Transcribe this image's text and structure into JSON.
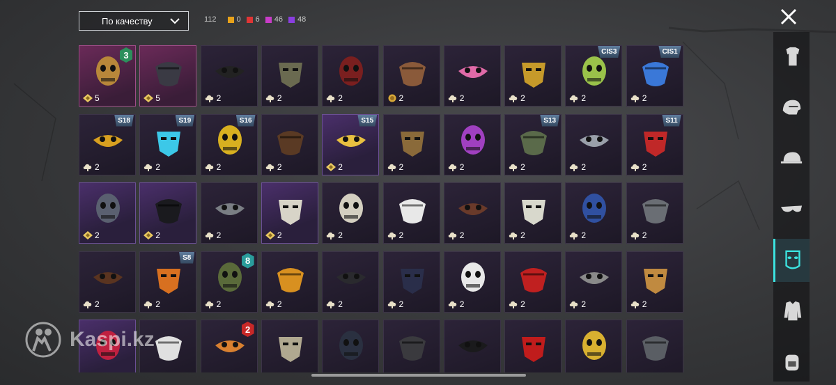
{
  "sort": {
    "label": "По качеству"
  },
  "counts": {
    "total": "112",
    "tiers": [
      {
        "value": "0",
        "color": "#e8a21a"
      },
      {
        "value": "6",
        "color": "#e03535"
      },
      {
        "value": "46",
        "color": "#c83cc8"
      },
      {
        "value": "48",
        "color": "#8a3ee0"
      }
    ]
  },
  "sidebar": {
    "categories": [
      {
        "name": "outfit",
        "icon": "outfit-icon"
      },
      {
        "name": "helmet",
        "icon": "helmet-icon"
      },
      {
        "name": "hat",
        "icon": "cap-icon"
      },
      {
        "name": "glasses",
        "icon": "glasses-icon"
      },
      {
        "name": "mask",
        "icon": "mask-icon",
        "active": true
      },
      {
        "name": "jacket",
        "icon": "jacket-icon"
      },
      {
        "name": "backpack",
        "icon": "backpack-icon"
      }
    ]
  },
  "watermark": "Kaspi.kz",
  "items": [
    {
      "name": "golden skull mask",
      "qty": "5",
      "currency": "coin-diamond",
      "tier": "legend",
      "level": "3",
      "levelColor": "#2c8f5c",
      "color": "#b8873a"
    },
    {
      "name": "bandana skull mask",
      "qty": "5",
      "currency": "coin-diamond",
      "tier": "legend",
      "color": "#3a3a44"
    },
    {
      "name": "black half mask",
      "qty": "2",
      "currency": "coin-cloud",
      "tier": "",
      "color": "#222"
    },
    {
      "name": "hockey mask olive",
      "qty": "2",
      "currency": "coin-cloud",
      "tier": "",
      "color": "#6a6a50"
    },
    {
      "name": "goggle red lens",
      "qty": "2",
      "currency": "coin-cloud",
      "tier": "",
      "color": "#7a1f1f"
    },
    {
      "name": "bear head mask",
      "qty": "2",
      "currency": "coin-gold",
      "tier": "",
      "color": "#8a5a3a"
    },
    {
      "name": "pink pig mask",
      "qty": "2",
      "currency": "coin-cloud",
      "tier": "",
      "color": "#e06aa8"
    },
    {
      "name": "tech visor mask",
      "qty": "2",
      "currency": "coin-cloud",
      "tier": "",
      "color": "#c69a2a"
    },
    {
      "name": "green leaf bandana",
      "qty": "2",
      "currency": "coin-cloud",
      "tier": "",
      "badge": "CIS3",
      "color": "#9ac24a"
    },
    {
      "name": "blue white bandana",
      "qty": "2",
      "currency": "coin-cloud",
      "tier": "",
      "badge": "CIS1",
      "color": "#3a78d8"
    },
    {
      "name": "neon face mask",
      "qty": "2",
      "currency": "coin-cloud",
      "tier": "",
      "badge": "S18",
      "color": "#d8a020"
    },
    {
      "name": "cyber visor",
      "qty": "2",
      "currency": "coin-cloud",
      "tier": "",
      "badge": "S19",
      "color": "#3cc8e8"
    },
    {
      "name": "yellow respirator",
      "qty": "2",
      "currency": "coin-cloud",
      "tier": "",
      "badge": "S16",
      "color": "#d8b020"
    },
    {
      "name": "brown bandana",
      "qty": "2",
      "currency": "coin-cloud",
      "tier": "",
      "color": "#5a3a24"
    },
    {
      "name": "gold horned skull",
      "qty": "2",
      "currency": "coin-diamond",
      "tier": "rare",
      "badge": "S15",
      "color": "#e8c040"
    },
    {
      "name": "bronze eye mask",
      "qty": "2",
      "currency": "coin-cloud",
      "tier": "",
      "color": "#8a6a3a"
    },
    {
      "name": "purple gas mask",
      "qty": "2",
      "currency": "coin-cloud",
      "tier": "",
      "color": "#a040c0"
    },
    {
      "name": "green goggles mask",
      "qty": "2",
      "currency": "coin-cloud",
      "tier": "",
      "badge": "S13",
      "color": "#5a6a4a"
    },
    {
      "name": "steel knight mask",
      "qty": "2",
      "currency": "coin-cloud",
      "tier": "",
      "color": "#9aa0aa"
    },
    {
      "name": "red half mask",
      "qty": "2",
      "currency": "coin-cloud",
      "tier": "",
      "badge": "S11",
      "color": "#c02828"
    },
    {
      "name": "grey cloth wrap",
      "qty": "2",
      "currency": "coin-diamond",
      "tier": "rare",
      "color": "#5a6070"
    },
    {
      "name": "black balaclava",
      "qty": "2",
      "currency": "coin-diamond",
      "tier": "rare",
      "color": "#1a1a1e"
    },
    {
      "name": "tactical helmet mask",
      "qty": "2",
      "currency": "coin-cloud",
      "tier": "",
      "color": "#7a7e84"
    },
    {
      "name": "mummy wrap mask",
      "qty": "2",
      "currency": "coin-diamond",
      "tier": "rare",
      "color": "#d8d4c8"
    },
    {
      "name": "bone skull mask",
      "qty": "2",
      "currency": "coin-cloud",
      "tier": "",
      "color": "#d4cfc0"
    },
    {
      "name": "clown mask",
      "qty": "2",
      "currency": "coin-cloud",
      "tier": "",
      "color": "#e8e8e8"
    },
    {
      "name": "brown muzzle",
      "qty": "2",
      "currency": "coin-cloud",
      "tier": "",
      "color": "#6a3a2a"
    },
    {
      "name": "white bandana",
      "qty": "2",
      "currency": "coin-cloud",
      "tier": "",
      "color": "#d8d8cc"
    },
    {
      "name": "flag bandana",
      "qty": "2",
      "currency": "coin-cloud",
      "tier": "",
      "color": "#3050a0"
    },
    {
      "name": "grey face mask",
      "qty": "2",
      "currency": "coin-cloud",
      "tier": "",
      "color": "#6a6e74"
    },
    {
      "name": "brown wig",
      "qty": "2",
      "currency": "coin-cloud",
      "tier": "",
      "color": "#5a3420"
    },
    {
      "name": "flame bandana",
      "qty": "2",
      "currency": "coin-cloud",
      "tier": "",
      "badge": "S8",
      "color": "#d87020"
    },
    {
      "name": "camo hockey mask",
      "qty": "2",
      "currency": "coin-cloud",
      "tier": "",
      "level": "8",
      "levelColor": "#2a9c9c",
      "color": "#5a6a3a"
    },
    {
      "name": "orange studded mask",
      "qty": "2",
      "currency": "coin-cloud",
      "tier": "",
      "color": "#d89020"
    },
    {
      "name": "black respirator",
      "qty": "2",
      "currency": "coin-cloud",
      "tier": "",
      "color": "#2a2a2e"
    },
    {
      "name": "dark gas mask",
      "qty": "2",
      "currency": "coin-cloud",
      "tier": "",
      "color": "#2a2e4a"
    },
    {
      "name": "teeth grin mask",
      "qty": "2",
      "currency": "coin-cloud",
      "tier": "",
      "color": "#e8e8e8"
    },
    {
      "name": "red tengu mask",
      "qty": "2",
      "currency": "coin-cloud",
      "tier": "",
      "color": "#c02020"
    },
    {
      "name": "oni mask",
      "qty": "2",
      "currency": "coin-cloud",
      "tier": "",
      "color": "#8a8a8a"
    },
    {
      "name": "painted hockey mask",
      "qty": "2",
      "currency": "coin-cloud",
      "tier": "",
      "color": "#c08a40"
    },
    {
      "name": "shark grin mask",
      "qty": "",
      "currency": "",
      "tier": "rare",
      "color": "#c02040"
    },
    {
      "name": "white cloth mask",
      "qty": "",
      "currency": "",
      "tier": "",
      "color": "#e0e0e0"
    },
    {
      "name": "orange stitched mask",
      "qty": "",
      "currency": "",
      "tier": "",
      "level": "2",
      "levelColor": "#c82828",
      "color": "#d88030"
    },
    {
      "name": "battle skull mask",
      "qty": "",
      "currency": "",
      "tier": "",
      "color": "#b0a890"
    },
    {
      "name": "dark demon mask",
      "qty": "",
      "currency": "",
      "tier": "",
      "color": "#2a3040"
    },
    {
      "name": "armored jaw mask",
      "qty": "",
      "currency": "",
      "tier": "",
      "color": "#3a3a3e"
    },
    {
      "name": "black bandana",
      "qty": "",
      "currency": "",
      "tier": "",
      "color": "#1a1a1c"
    },
    {
      "name": "red ribbon",
      "qty": "",
      "currency": "",
      "tier": "",
      "color": "#c01c1c"
    },
    {
      "name": "gold sequin mask",
      "qty": "",
      "currency": "",
      "tier": "",
      "color": "#d8b030"
    },
    {
      "name": "iron welder mask",
      "qty": "",
      "currency": "",
      "tier": "",
      "color": "#5a5e64"
    }
  ]
}
